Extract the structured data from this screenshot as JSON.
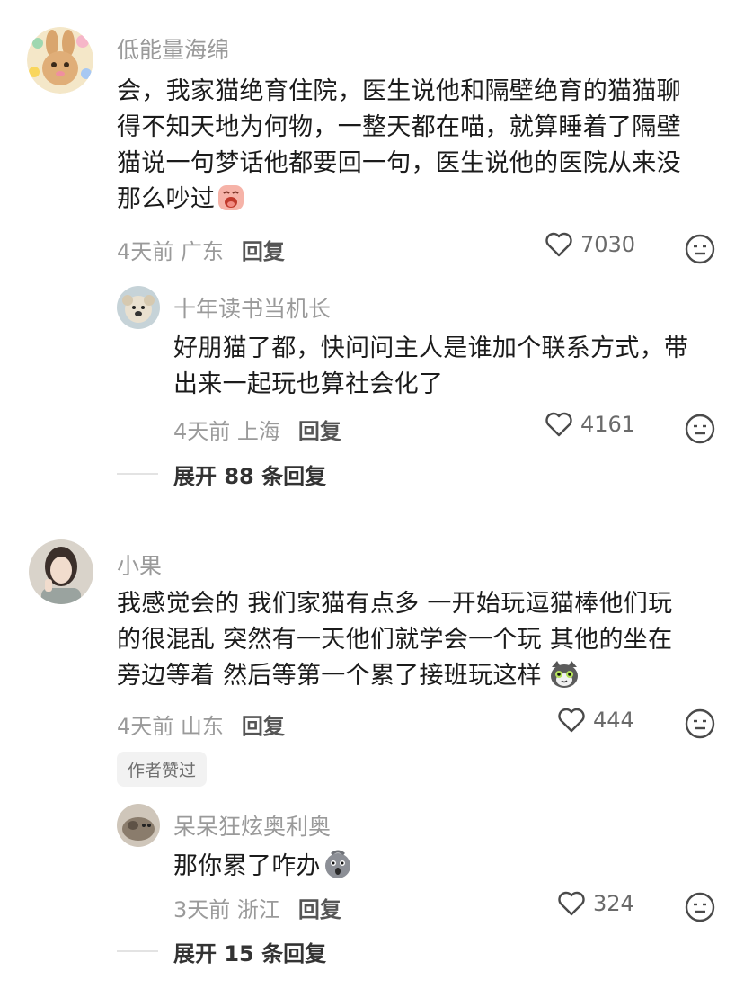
{
  "threads": [
    {
      "comment": {
        "username": "低能量海绵",
        "lines": [
          "会，我家猫绝育住院，医生说他和隔壁绝育的猫猫聊",
          "得不知天地为何物，一整天都在喵，就算睡着了隔壁",
          "猫说一句梦话他都要回一句，医生说他的医院从来没",
          "那么吵过"
        ],
        "time_location": "4天前 广东",
        "reply_label": "回复",
        "likes": "7030"
      },
      "reply": {
        "username": "十年读书当机长",
        "lines": [
          "好朋猫了都，快问问主人是谁加个联系方式，带",
          "出来一起玩也算社会化了"
        ],
        "time_location": "4天前 上海",
        "reply_label": "回复",
        "likes": "4161"
      },
      "expand_label": "展开 88 条回复"
    },
    {
      "comment": {
        "username": "小果",
        "lines": [
          "我感觉会的 我们家猫有点多 一开始玩逗猫棒他们玩",
          "的很混乱 突然有一天他们就学会一个玩 其他的坐在",
          "旁边等着 然后等第一个累了接班玩这样"
        ],
        "time_location": "4天前 山东",
        "reply_label": "回复",
        "likes": "444",
        "badge": "作者赞过"
      },
      "reply": {
        "username": "呆呆狂炫奥利奥",
        "lines": [
          "那你累了咋办"
        ],
        "time_location": "3天前 浙江",
        "reply_label": "回复",
        "likes": "324"
      },
      "expand_label": "展开 15 条回复"
    }
  ],
  "colors": {
    "muted": "#9a9a9a",
    "text": "#1b1b1b",
    "divider": "#e3e3e3"
  },
  "icons": [
    "heart-outline-icon",
    "dislike-face-icon",
    "crying-face-emoji",
    "cat-face-emoji",
    "shocked-face-emoji"
  ]
}
